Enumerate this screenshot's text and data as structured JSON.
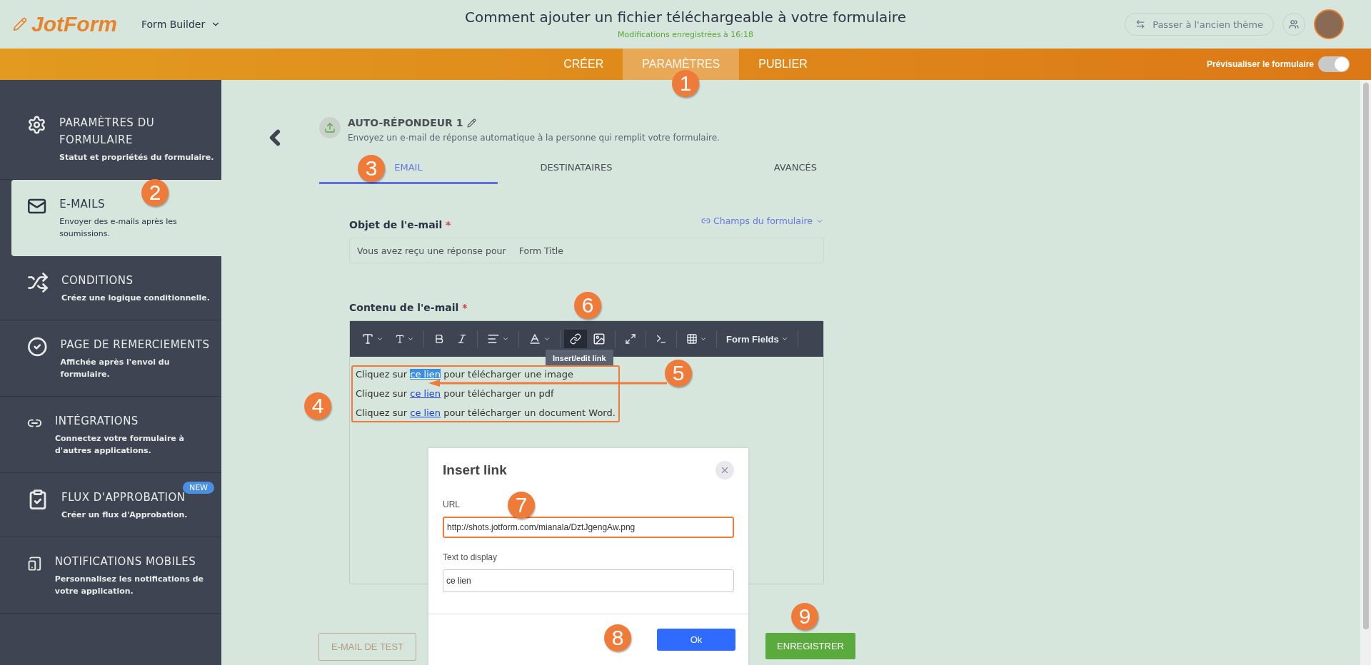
{
  "header": {
    "logo": "JotForm",
    "app_menu": "Form Builder",
    "title": "Comment ajouter un fichier téléchargeable à votre formulaire",
    "saved": "Modifications enregistrées à 16:18",
    "theme_button": "Passer à l'ancien thème"
  },
  "nav": {
    "tabs": [
      {
        "label": "CRÉER",
        "selected": false
      },
      {
        "label": "PARAMÈTRES",
        "selected": true
      },
      {
        "label": "PUBLIER",
        "selected": false
      }
    ],
    "preview_label": "Prévisualiser le formulaire",
    "preview_on": true
  },
  "sidebar": {
    "items": [
      {
        "kind": "gear",
        "title": "PARAMÈTRES DU FORMULAIRE",
        "description": "Statut et propriétés du formulaire.",
        "selected": false
      },
      {
        "kind": "mail",
        "title": "E-MAILS",
        "description": "Envoyer des e-mails après les soumissions.",
        "selected": true
      },
      {
        "kind": "conditions",
        "title": "CONDITIONS",
        "description": "Créez une logique conditionnelle.",
        "selected": false
      },
      {
        "kind": "check",
        "title": "PAGE DE REMERCIEMENTS",
        "description": "Affichée après l'envoi du formulaire.",
        "selected": false
      },
      {
        "kind": "link",
        "title": "INTÉGRATIONS",
        "description": "Connectez votre formulaire à d'autres applications.",
        "selected": false
      },
      {
        "kind": "approval",
        "title": "FLUX D'APPROBATION",
        "description": "Créer un flux d'Approbation.",
        "selected": false,
        "badge": "NEW"
      },
      {
        "kind": "mobile",
        "title": "NOTIFICATIONS MOBILES",
        "description": "Personnalisez les notifications de votre application.",
        "selected": false
      }
    ]
  },
  "autoresponder": {
    "title": "AUTO-RÉPONDEUR 1",
    "description": "Envoyez un e-mail de réponse automatique à la personne qui remplit votre formulaire."
  },
  "tabs": [
    {
      "label": "EMAIL",
      "selected": true
    },
    {
      "label": "DESTINATAIRES",
      "selected": false
    },
    {
      "label": "AVANCÉS",
      "selected": false
    }
  ],
  "subject": {
    "label": "Objet de l'e-mail",
    "required_mark": "*",
    "fields_menu": "Champs du formulaire",
    "value": "Vous avez reçu une réponse pour",
    "tag": "Form Title"
  },
  "content": {
    "label": "Contenu de l'e-mail",
    "required_mark": "*",
    "form_fields": "Form Fields",
    "tooltip": "Insert/edit link",
    "lines": [
      {
        "before": "Cliquez sur",
        "link": "ce lien",
        "after": "pour télécharger une image",
        "selected": true
      },
      {
        "before": "Cliquez sur",
        "link": "ce lien",
        "after": "pour télécharger un pdf",
        "selected": false
      },
      {
        "before": "Cliquez sur",
        "link": "ce lien",
        "after": "pour télécharger un document Word.",
        "selected": false
      }
    ]
  },
  "dialog": {
    "title": "Insert link",
    "url_label": "URL",
    "url_value": "http://shots.jotform.com/mianala/DztJgengAw.png",
    "text_label": "Text to display",
    "text_value": "ce lien",
    "ok": "Ok"
  },
  "buttons": {
    "test": "E-MAIL DE TEST",
    "save": "ENREGISTRER"
  },
  "annotations": [
    "1",
    "2",
    "3",
    "4",
    "5",
    "6",
    "7",
    "8",
    "9"
  ]
}
